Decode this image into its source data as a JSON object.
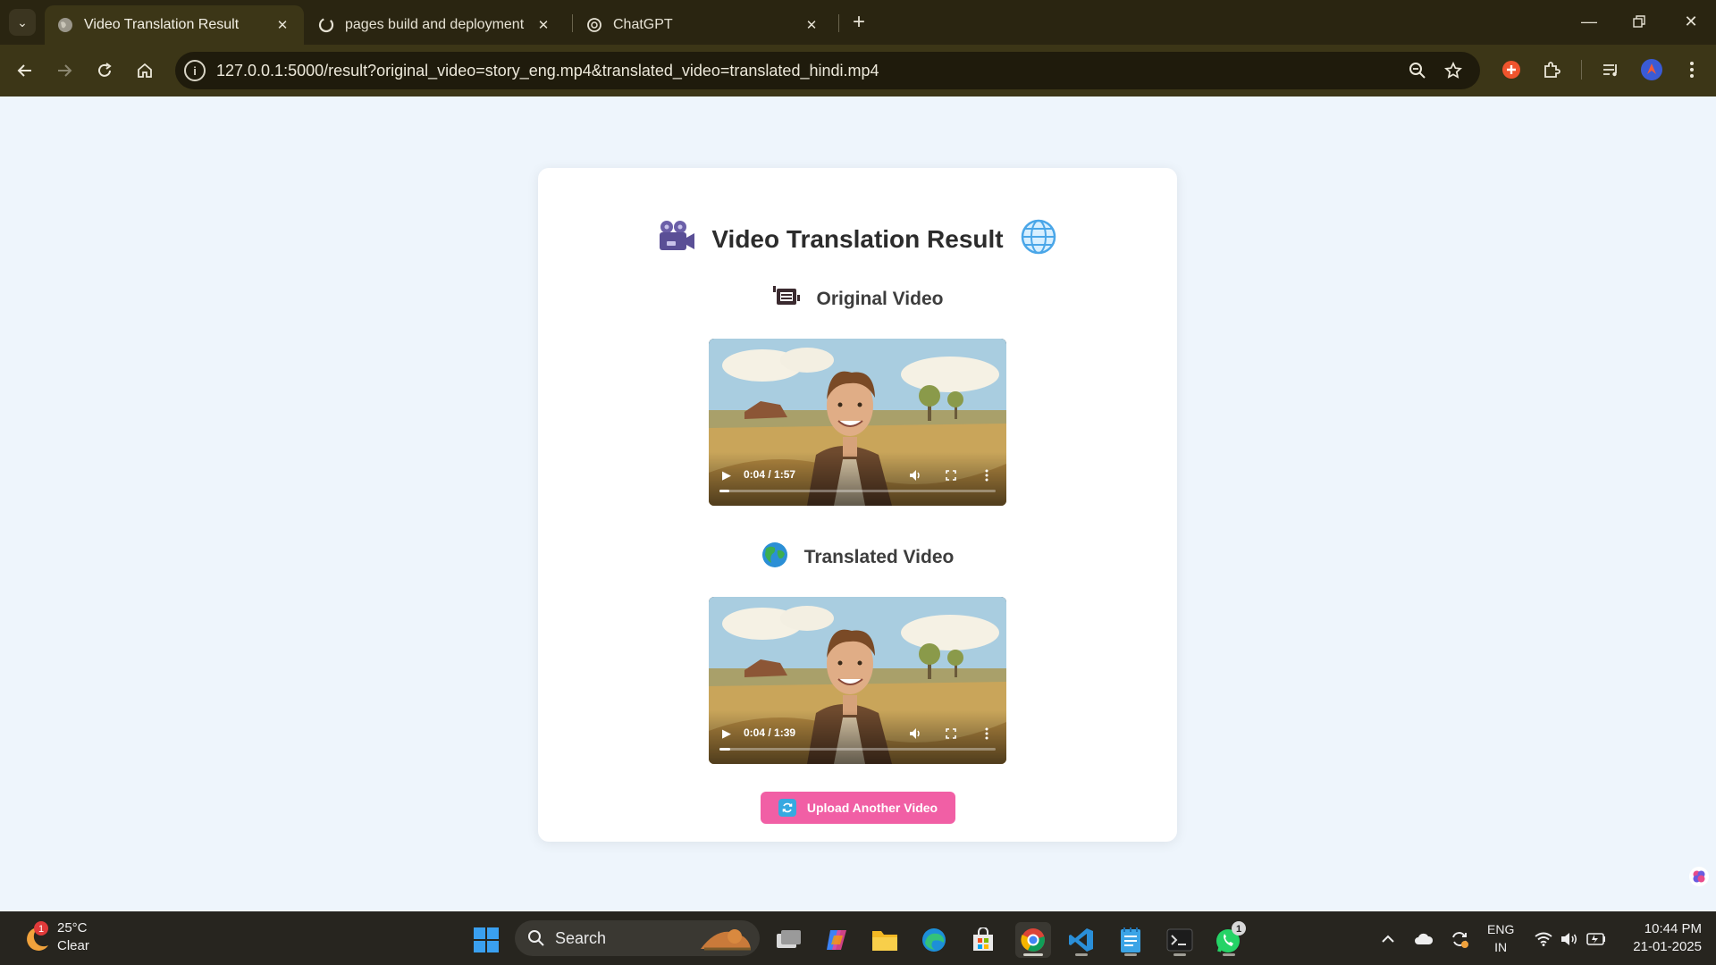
{
  "browser": {
    "tabs": [
      {
        "title": "Video Translation Result",
        "active": true
      },
      {
        "title": "pages build and deployment · T",
        "active": false
      },
      {
        "title": "ChatGPT",
        "active": false
      }
    ],
    "url": "127.0.0.1:5000/result?original_video=story_eng.mp4&translated_video=translated_hindi.mp4",
    "theme_color": "#3c3617"
  },
  "page": {
    "title": "Video Translation Result",
    "original_section_title": "Original Video",
    "translated_section_title": "Translated Video",
    "upload_button_label": "Upload Another Video",
    "upload_button_color": "#f15fa5",
    "background": "#eef5fc"
  },
  "videos": {
    "original": {
      "time": "0:04 / 1:57",
      "progress": 0.034
    },
    "translated": {
      "time": "0:04 / 1:39",
      "progress": 0.04
    }
  },
  "taskbar": {
    "weather_badge": "1",
    "temperature": "25°C",
    "condition": "Clear",
    "search_label": "Search",
    "whatsapp_badge": "1",
    "lang_line1": "ENG",
    "lang_line2": "IN",
    "time": "10:44 PM",
    "date": "21-01-2025"
  }
}
